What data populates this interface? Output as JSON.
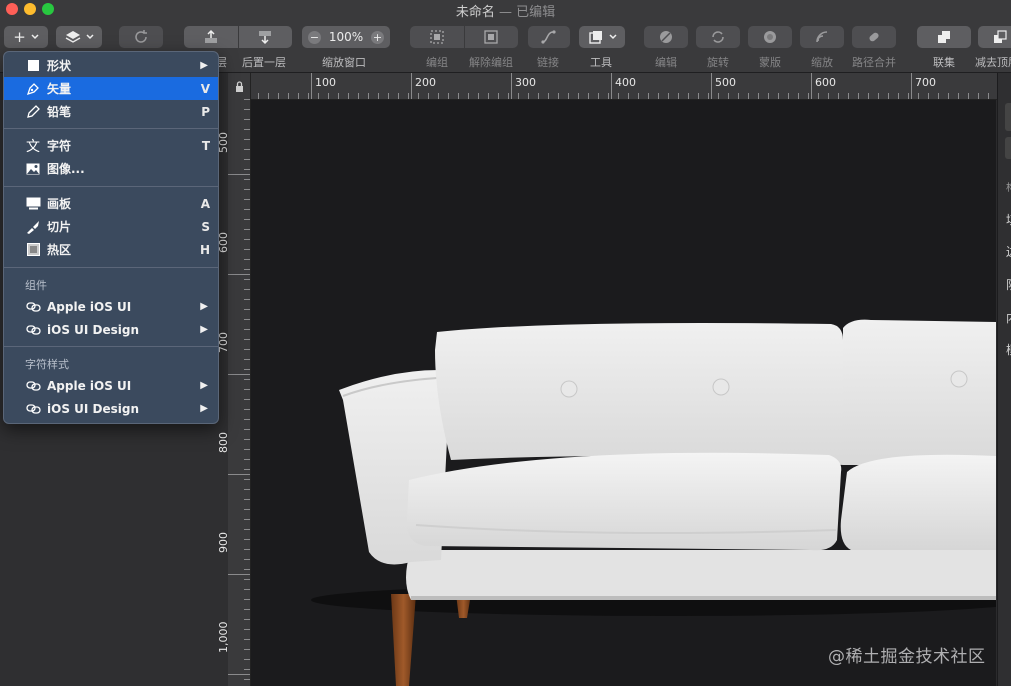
{
  "window": {
    "title": "未命名",
    "status": "已编辑",
    "separator": "—"
  },
  "toolbar": {
    "zoom_value": "100%",
    "labels": {
      "forward": "层",
      "backward": "后置一层",
      "zoom": "缩放窗口",
      "group": "编组",
      "ungroup": "解除编组",
      "link": "链接",
      "tools": "工具",
      "edit": "编辑",
      "rotate": "旋转",
      "mask": "蒙版",
      "scale": "缩放",
      "path_combine": "路径合并",
      "union": "联集",
      "subtract": "减去顶层"
    }
  },
  "insert_menu": {
    "items": [
      {
        "label": "形状",
        "shortcut": "",
        "icon": "square-icon",
        "submenu": true
      },
      {
        "label": "矢量",
        "shortcut": "V",
        "icon": "pen-icon",
        "highlighted": true
      },
      {
        "label": "铅笔",
        "shortcut": "P",
        "icon": "pencil-icon"
      },
      {
        "label": "字符",
        "shortcut": "T",
        "icon": "text-icon"
      },
      {
        "label": "图像...",
        "shortcut": "",
        "icon": "image-icon"
      },
      {
        "label": "画板",
        "shortcut": "A",
        "icon": "artboard-icon"
      },
      {
        "label": "切片",
        "shortcut": "S",
        "icon": "knife-icon"
      },
      {
        "label": "热区",
        "shortcut": "H",
        "icon": "hotspot-icon"
      }
    ],
    "components_header": "组件",
    "components": [
      {
        "label": "Apple iOS UI",
        "icon": "link-icon"
      },
      {
        "label": "iOS UI Design",
        "icon": "link-icon"
      }
    ],
    "text_styles_header": "字符样式",
    "text_styles": [
      {
        "label": "Apple iOS UI",
        "icon": "link-icon"
      },
      {
        "label": "iOS UI Design",
        "icon": "link-icon"
      }
    ]
  },
  "ruler": {
    "top": [
      "100",
      "200",
      "300",
      "400",
      "500",
      "600",
      "700"
    ],
    "left": [
      "500",
      "600",
      "700",
      "800",
      "900",
      "1,000"
    ]
  },
  "right_panel_chars": [
    "构",
    "填",
    "边",
    "阴",
    "内",
    "模"
  ],
  "watermark": "@稀土掘金技术社区",
  "colors": {
    "accent": "#1a6be0",
    "menu_bg": "#3b4a5e",
    "canvas": "#1b1b1d",
    "toolbar": "#3a3a3c"
  }
}
